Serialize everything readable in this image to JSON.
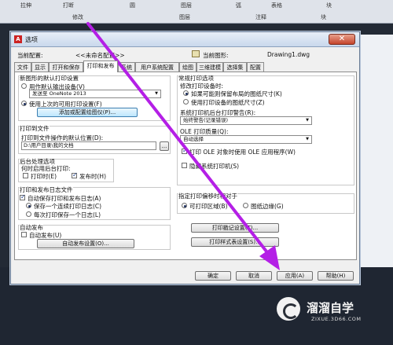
{
  "ribbon": {
    "top_items": [
      "拉伸",
      "打断",
      "圆",
      "图层",
      "弧",
      "表格",
      "块"
    ],
    "groups": [
      "修改",
      "图层",
      "注释",
      "块"
    ]
  },
  "dialog": {
    "title": "选项",
    "close": "✕",
    "current_profile_label": "当前配置:",
    "current_profile_value": "<<未命名配置>>",
    "current_drawing_label": "当前图形:",
    "current_drawing_value": "Drawing1.dwg",
    "tabs": [
      "文件",
      "显示",
      "打开和保存",
      "打印和发布",
      "系统",
      "用户系统配置",
      "绘图",
      "三维建模",
      "选择集",
      "配置"
    ],
    "active_tab": "打印和发布"
  },
  "left": {
    "new_default_group": "新图形的默认打印设置",
    "opt_default_device": "用作默认输出设备(V)",
    "device_value": "发送至 OneNote 2013",
    "opt_last_used": "使用上次的可用打印设置(F)",
    "add_plotter_btn": "添加或配置绘图仪(P)...",
    "print_to_file_group": "打印到文件",
    "default_location_label": "打印到文件操作的默认位置(D):",
    "default_location_value": "D:\\用户目录\\我的文档",
    "browse_btn": "...",
    "background_group": "后台处理选项",
    "background_when": "何时启用后台打印:",
    "bg_plot": "打印时(E)",
    "bg_publish": "发布时(H)",
    "log_group": "打印和发布日志文件",
    "auto_save_log": "自动保存打印和发布日志(A)",
    "keep_one_log": "保存一个连续打印日志(C)",
    "per_plot_log": "每次打印保存一个日志(L)",
    "auto_publish_group": "自动发布",
    "auto_publish": "自动发布(U)",
    "auto_publish_btn": "自动发布设置(O)..."
  },
  "right": {
    "general_group": "常规打印选项",
    "change_device_label": "修改打印设备时:",
    "keep_layout_paper": "如果可能则保留布局的图纸尺寸(K)",
    "use_device_paper": "使用打印设备的图纸尺寸(Z)",
    "spool_alert_label": "系统打印机后台打印警告(R):",
    "spool_alert_value": "始终警告(记录错误)",
    "ole_quality_label": "OLE 打印质量(Q):",
    "ole_quality_value": "自动选择",
    "use_ole_app": "打印 OLE 对象时使用 OLE 应用程序(W)",
    "hide_system_printers": "隐藏系统打印机(S)",
    "offset_group": "指定打印偏移时相对于",
    "printable_area": "可打印区域(B)",
    "paper_edge": "图纸边缘(G)",
    "stamp_btn": "打印戳记设置(T)...",
    "style_btn": "打印样式表设置(S)..."
  },
  "footer": {
    "ok": "确定",
    "cancel": "取消",
    "apply": "应用(A)",
    "help": "帮助(H)"
  },
  "watermark": {
    "main": "溜溜自学",
    "sub": "ZIXUE.3D66.COM"
  },
  "colors": {
    "arrow": "#b41fe6",
    "titlebar": "#c9d8ec",
    "close_button": "#c4442c"
  }
}
